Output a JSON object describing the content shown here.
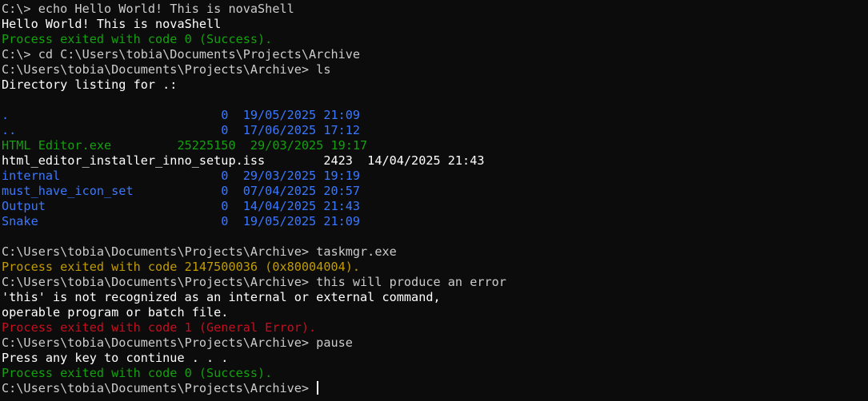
{
  "colors": {
    "background": "#0c0c0c",
    "output": "#ffffff",
    "prompt": "#cccccc",
    "success": "#13a10e",
    "directory": "#3b78ff",
    "warning": "#c19c00",
    "error": "#c50f1f"
  },
  "terminal": {
    "lines": [
      "C:\\> echo Hello World! This is novaShell",
      "Hello World! This is novaShell",
      "Process exited with code 0 (Success).",
      "C:\\> cd C:\\Users\\tobia\\Documents\\Projects\\Archive",
      "C:\\Users\\tobia\\Documents\\Projects\\Archive> ls",
      "Directory listing for .:",
      "",
      ".                             0  19/05/2025 21:09",
      "..                            0  17/06/2025 17:12",
      "HTML Editor.exe         25225150  29/03/2025 19:17",
      "html_editor_installer_inno_setup.iss        2423  14/04/2025 21:43",
      "internal                      0  29/03/2025 19:19",
      "must_have_icon_set            0  07/04/2025 20:57",
      "Output                        0  14/04/2025 21:43",
      "Snake                         0  19/05/2025 21:09",
      "",
      "C:\\Users\\tobia\\Documents\\Projects\\Archive> taskmgr.exe",
      "Process exited with code 2147500036 (0x80004004).",
      "C:\\Users\\tobia\\Documents\\Projects\\Archive> this will produce an error",
      "'this' is not recognized as an internal or external command,",
      "operable program or batch file.",
      "Process exited with code 1 (General Error).",
      "C:\\Users\\tobia\\Documents\\Projects\\Archive> pause",
      "Press any key to continue . . .",
      "Process exited with code 0 (Success).",
      "C:\\Users\\tobia\\Documents\\Projects\\Archive> "
    ]
  }
}
